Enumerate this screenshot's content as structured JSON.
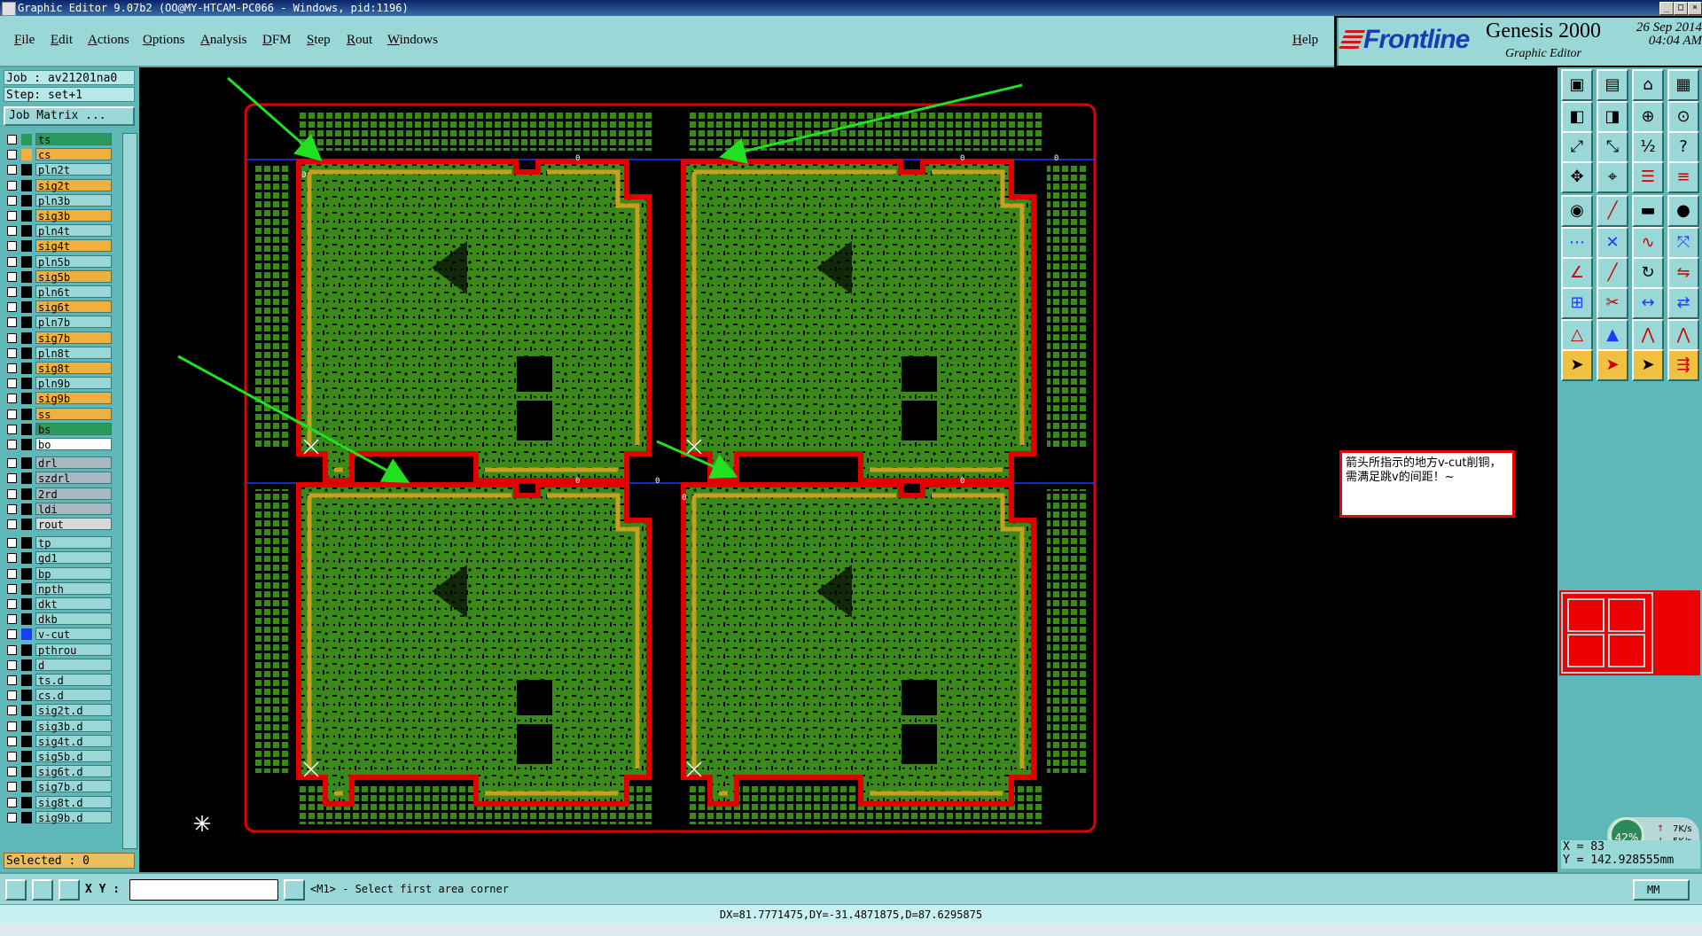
{
  "window": {
    "title": "Graphic Editor 9.07b2 (OO@MY-HTCAM-PC066 - Windows, pid:1196)",
    "controls": [
      "_",
      "□",
      "×"
    ]
  },
  "menu": {
    "items": [
      "File",
      "Edit",
      "Actions",
      "Options",
      "Analysis",
      "DFM",
      "Step",
      "Rout",
      "Windows"
    ],
    "help": "Help"
  },
  "brand": {
    "logo": "Frontline",
    "product": "Genesis 2000",
    "subtitle": "Graphic Editor",
    "date": "26 Sep 2014",
    "time": "04:04 AM"
  },
  "job": {
    "job_label": "Job : av21201na0",
    "step_label": "Step: set+1",
    "matrix_button": "Job Matrix ..."
  },
  "layers": [
    {
      "name": "ts",
      "color": "#2a9a5a",
      "bg": "#2a9a5a"
    },
    {
      "name": "cs",
      "color": "#f0b040",
      "bg": "#f0b040"
    },
    {
      "name": "pln2t",
      "color": "#000000",
      "bg": "#9ad8d8"
    },
    {
      "name": "sig2t",
      "color": "#000000",
      "bg": "#f0b040"
    },
    {
      "name": "pln3b",
      "color": "#000000",
      "bg": "#9ad8d8"
    },
    {
      "name": "sig3b",
      "color": "#000000",
      "bg": "#f0b040"
    },
    {
      "name": "pln4t",
      "color": "#000000",
      "bg": "#9ad8d8"
    },
    {
      "name": "sig4t",
      "color": "#000000",
      "bg": "#f0b040"
    },
    {
      "name": "pln5b",
      "color": "#000000",
      "bg": "#9ad8d8"
    },
    {
      "name": "sig5b",
      "color": "#000000",
      "bg": "#f0b040"
    },
    {
      "name": "pln6t",
      "color": "#000000",
      "bg": "#9ad8d8"
    },
    {
      "name": "sig6t",
      "color": "#000000",
      "bg": "#f0b040"
    },
    {
      "name": "pln7b",
      "color": "#000000",
      "bg": "#9ad8d8"
    },
    {
      "name": "sig7b",
      "color": "#000000",
      "bg": "#f0b040"
    },
    {
      "name": "pln8t",
      "color": "#000000",
      "bg": "#9ad8d8"
    },
    {
      "name": "sig8t",
      "color": "#000000",
      "bg": "#f0b040"
    },
    {
      "name": "pln9b",
      "color": "#000000",
      "bg": "#9ad8d8"
    },
    {
      "name": "sig9b",
      "color": "#000000",
      "bg": "#f0b040"
    },
    {
      "name": "ss",
      "color": "#000000",
      "bg": "#f0b040"
    },
    {
      "name": "bs",
      "color": "#000000",
      "bg": "#2a9a5a"
    },
    {
      "name": "bo",
      "color": "#000000",
      "bg": "#ffffff"
    },
    {
      "name": "drl",
      "color": "#000000",
      "bg": "#a8b8c0"
    },
    {
      "name": "szdrl",
      "color": "#000000",
      "bg": "#a8b8c0"
    },
    {
      "name": "2rd",
      "color": "#000000",
      "bg": "#a8b8c0"
    },
    {
      "name": "ldi",
      "color": "#000000",
      "bg": "#a8b8c0"
    },
    {
      "name": "rout",
      "color": "#000000",
      "bg": "#d8d8d8"
    },
    {
      "name": "tp",
      "color": "#000000",
      "bg": "#9ad8d8"
    },
    {
      "name": "gd1",
      "color": "#000000",
      "bg": "#9ad8d8"
    },
    {
      "name": "bp",
      "color": "#000000",
      "bg": "#9ad8d8"
    },
    {
      "name": "npth",
      "color": "#000000",
      "bg": "#9ad8d8"
    },
    {
      "name": "dkt",
      "color": "#000000",
      "bg": "#9ad8d8"
    },
    {
      "name": "dkb",
      "color": "#000000",
      "bg": "#9ad8d8"
    },
    {
      "name": "v-cut",
      "color": "#1a3cff",
      "bg": "#9ad8d8"
    },
    {
      "name": "pthrou",
      "color": "#000000",
      "bg": "#9ad8d8"
    },
    {
      "name": "d",
      "color": "#000000",
      "bg": "#9ad8d8"
    },
    {
      "name": "ts.d",
      "color": "#000000",
      "bg": "#9ad8d8"
    },
    {
      "name": "cs.d",
      "color": "#000000",
      "bg": "#9ad8d8"
    },
    {
      "name": "sig2t.d",
      "color": "#000000",
      "bg": "#9ad8d8"
    },
    {
      "name": "sig3b.d",
      "color": "#000000",
      "bg": "#9ad8d8"
    },
    {
      "name": "sig4t.d",
      "color": "#000000",
      "bg": "#9ad8d8"
    },
    {
      "name": "sig5b.d",
      "color": "#000000",
      "bg": "#9ad8d8"
    },
    {
      "name": "sig6t.d",
      "color": "#000000",
      "bg": "#9ad8d8"
    },
    {
      "name": "sig7b.d",
      "color": "#000000",
      "bg": "#9ad8d8"
    },
    {
      "name": "sig8t.d",
      "color": "#000000",
      "bg": "#9ad8d8"
    },
    {
      "name": "sig9b.d",
      "color": "#000000",
      "bg": "#9ad8d8"
    }
  ],
  "selected": "Selected : 0",
  "note": "箭头所指示的地方v-cut削铜，需满足跳v的间距！~",
  "panel_numbers": {
    "tl_left": "0",
    "tl_right": "0",
    "tr_left": "0",
    "tr_right": "0",
    "bl_left": "0",
    "bl_right": "0",
    "br_left": "0",
    "br_right": "0"
  },
  "coords": {
    "x": "X = 83",
    "y": "Y = 142.928555mm"
  },
  "network": {
    "percent": "42%",
    "up": "7K/s",
    "down": "5K/s"
  },
  "bottom": {
    "xy_label": "X Y :",
    "xy_value": "",
    "prompt": "<M1> - Select first area corner",
    "units": "MM"
  },
  "status": "DX=81.7771475,DY=-31.4871875,D=87.6295875",
  "colors": {
    "accent": "#9ad8d8",
    "copper": "#3a8a1a",
    "outline": "#e00000",
    "arrow": "#20e020",
    "vcut": "#1a3cff"
  },
  "toolbar_icons": [
    "open-job-icon",
    "save-icon",
    "home-icon",
    "grid-icon",
    "prev-step-icon",
    "next-step-icon",
    "zoom-in-icon",
    "zoom-home-icon",
    "fit-icon",
    "fit-vertical-icon",
    "scale-icon",
    "help-icon",
    "pan-icon",
    "snap-icon",
    "layers-icon",
    "layers-compare-icon",
    "pad-icon",
    "line-draw-icon",
    "measure-icon",
    "circle-icon",
    "node-icon",
    "cross-icon",
    "connect-icon",
    "move-node-icon",
    "angle-icon",
    "edge-icon",
    "rotate-icon",
    "flip-icon",
    "resize-icon",
    "cut-icon",
    "distance-icon",
    "replace-icon",
    "triangle-icon",
    "triangle-outline-icon",
    "peak-icon",
    "peak-bar-icon",
    "select-arrow-icon",
    "select-arrow-box-icon",
    "select-arrow-net-icon",
    "select-multi-icon"
  ]
}
